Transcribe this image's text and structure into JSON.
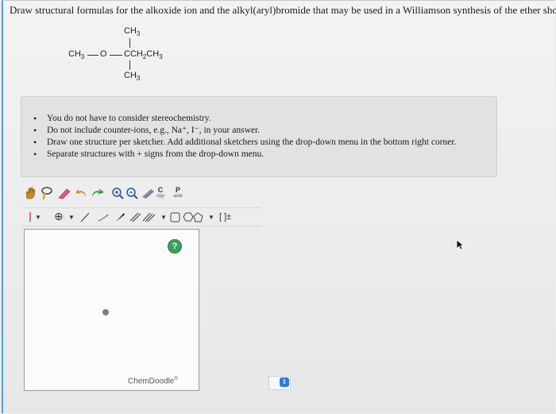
{
  "question": "Draw structural formulas for the alkoxide ion and the alkyl(aryl)bromide that may be used in a Williamson synthesis of the ether shown.",
  "molecule": {
    "top_methyl": "CH3",
    "left_group": "CH3",
    "oxygen": "O",
    "main_chain": "CCH2CH3",
    "bottom_methyl": "CH3"
  },
  "instructions": [
    "You do not have to consider stereochemistry.",
    "Do not include counter-ions, e.g., Na⁺, I⁻, in your answer.",
    "Draw one structure per sketcher. Add additional sketchers using the drop-down menu in the bottom right corner.",
    "Separate structures with + signs from the drop-down menu."
  ],
  "toolbar": {
    "copy_top": "C",
    "copy_bottom": "opy",
    "paste_top": "P",
    "paste_bottom": "aste",
    "charge_tool": "⊕",
    "bracket_tool": "[ ]±"
  },
  "sketcher": {
    "brand": "ChemDoodle",
    "brand_mark": "®",
    "help": "?"
  },
  "colors": {
    "accent": "#4aa3d8",
    "help": "#3aa05a",
    "select": "#2f7bd6"
  }
}
